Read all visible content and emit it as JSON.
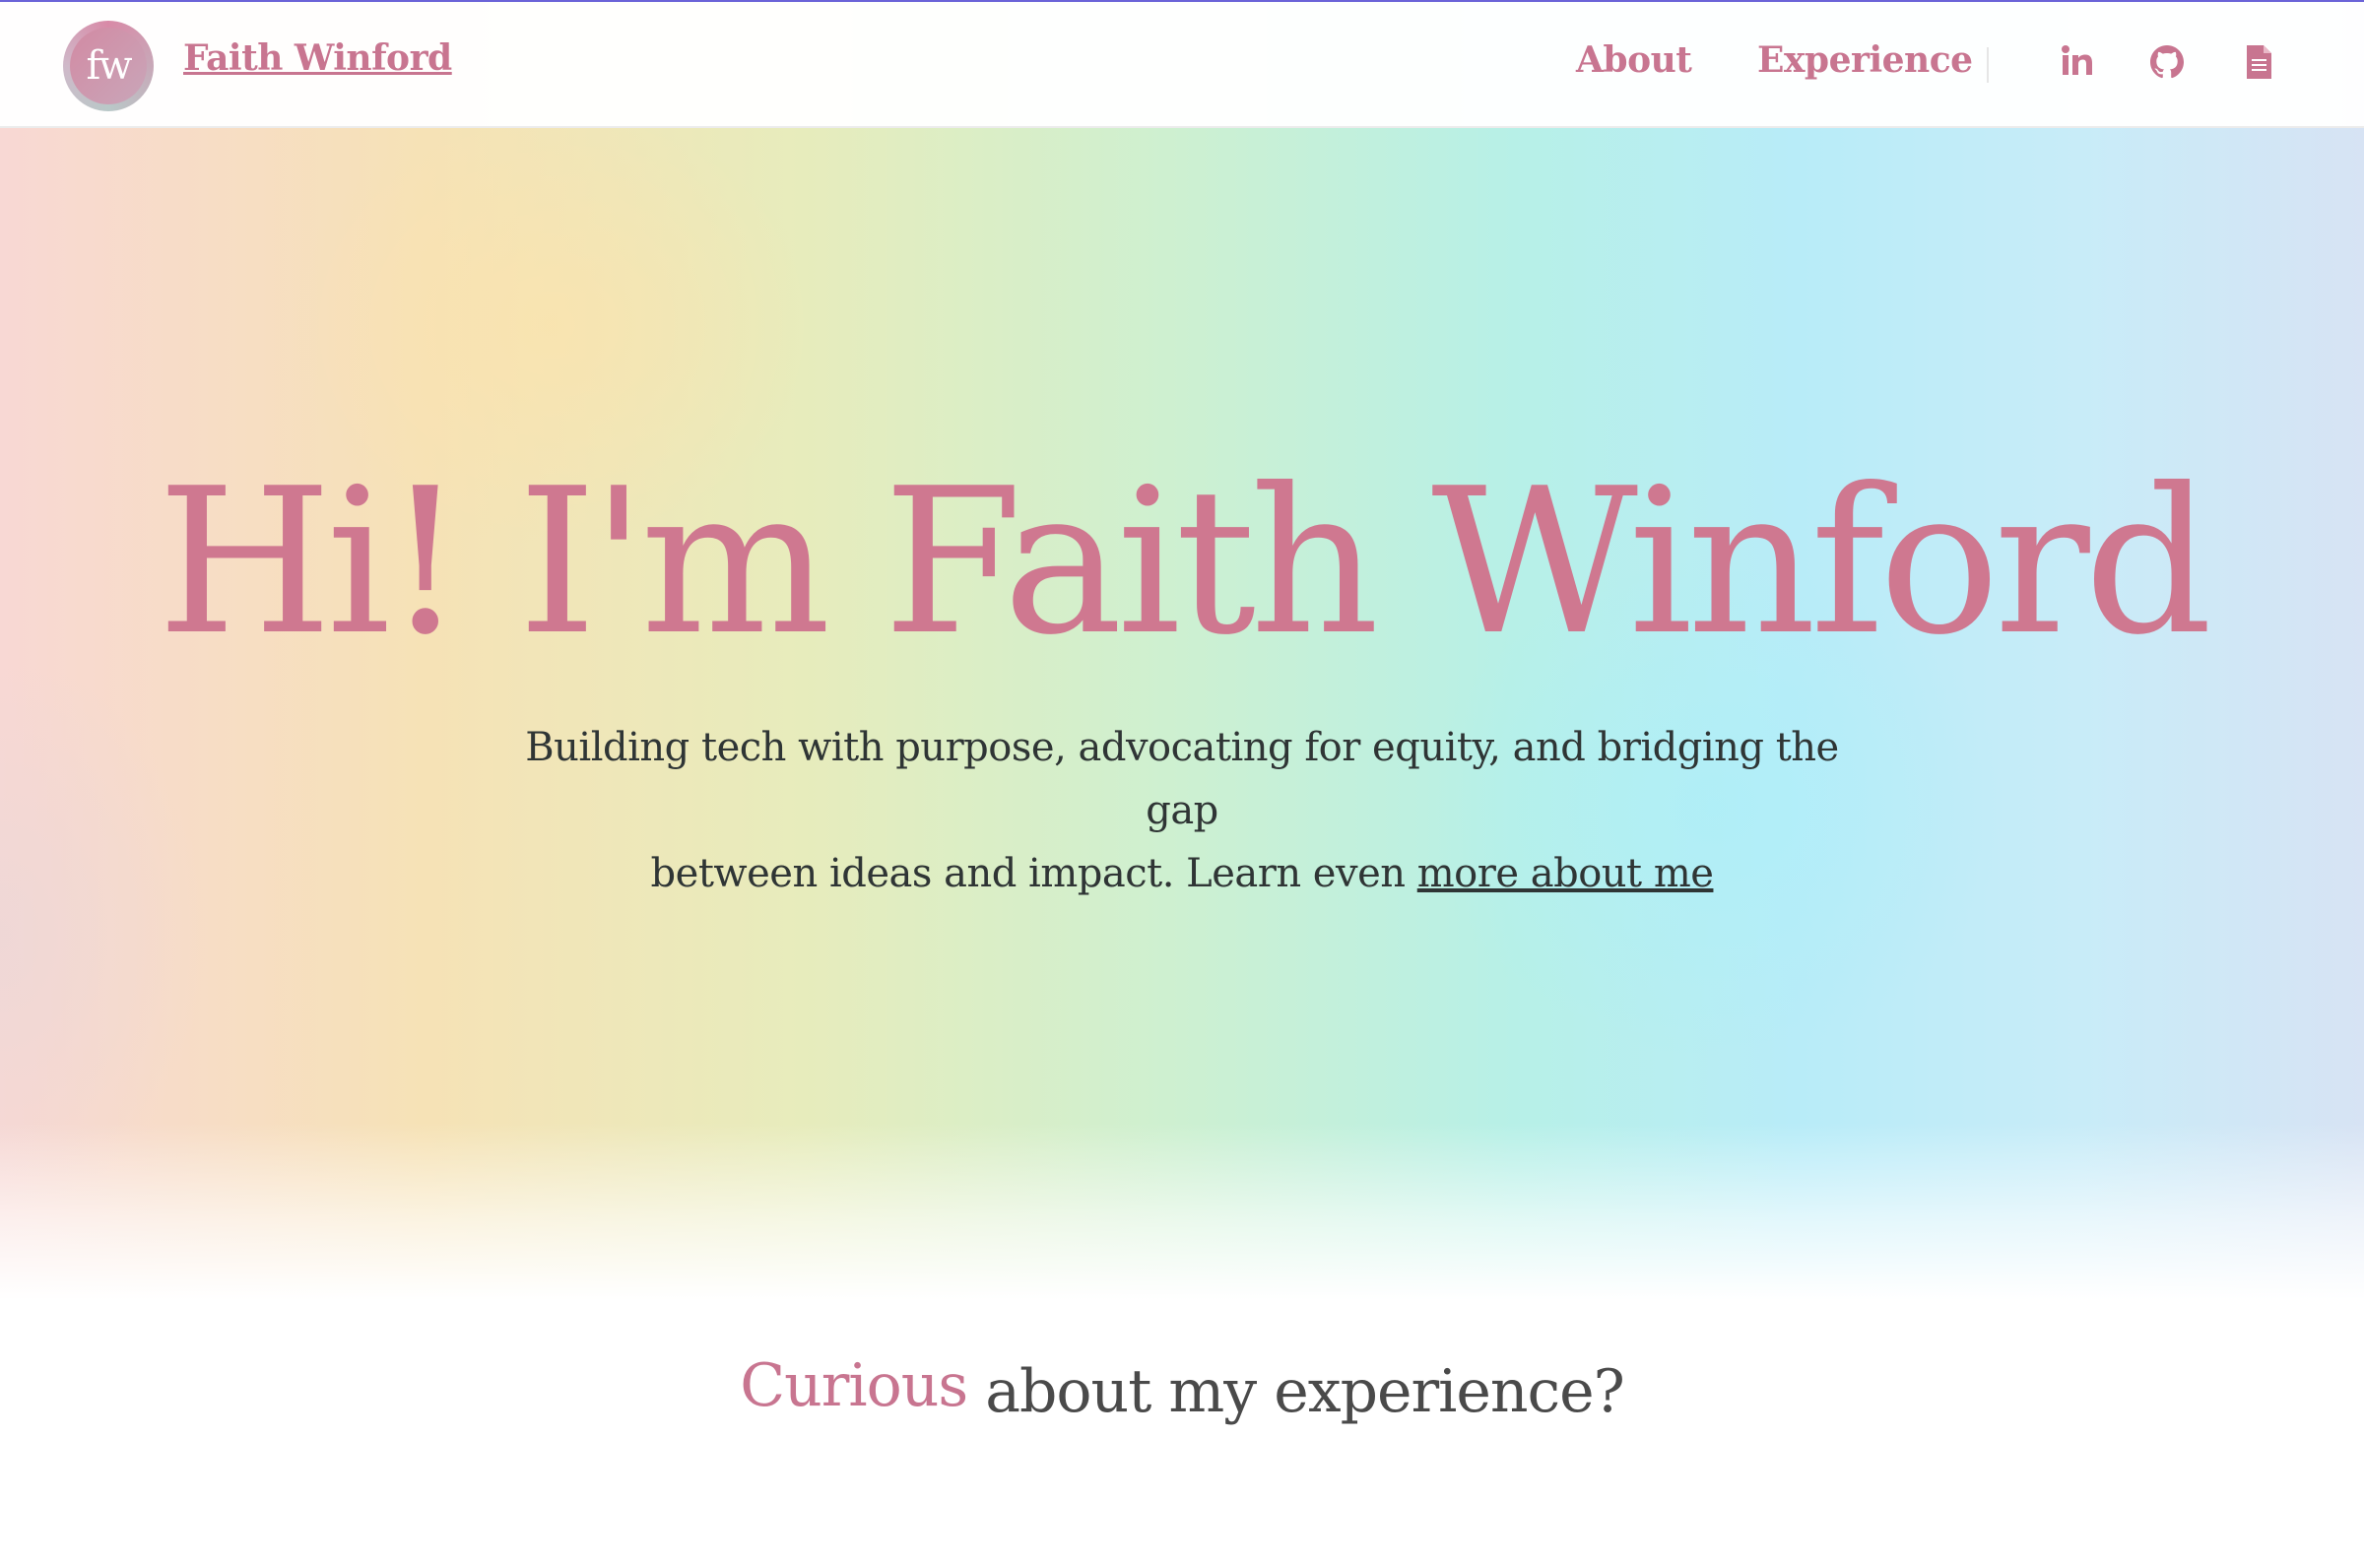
{
  "brand": {
    "logo_text": "fw",
    "name": "Faith Winford"
  },
  "nav": {
    "links": [
      {
        "label": "About"
      },
      {
        "label": "Experience"
      }
    ],
    "icons": [
      "linkedin-icon",
      "github-icon",
      "document-icon"
    ]
  },
  "hero": {
    "title": "Hi! I'm Faith Winford",
    "subtitle_line1": "Building tech with purpose, advocating for equity, and bridging the gap",
    "subtitle_line2_prefix": "between ideas and impact. Learn even ",
    "subtitle_link": "more about me"
  },
  "section": {
    "accent_word": "Curious",
    "heading_rest": "about my experience?"
  },
  "colors": {
    "accent": "#c87590",
    "text": "#2f3535",
    "top_line": "#6b63d8"
  }
}
